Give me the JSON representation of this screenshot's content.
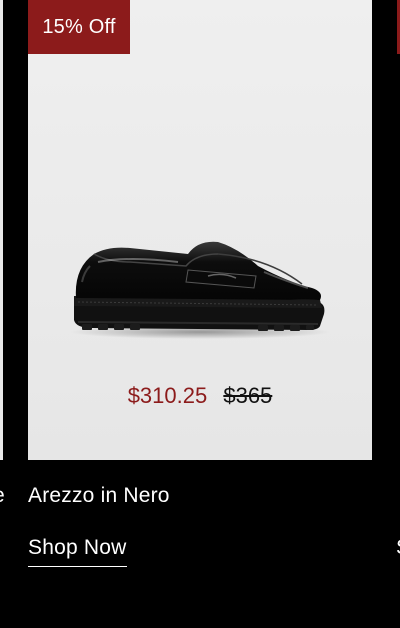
{
  "carousel": {
    "previous_card": {
      "name_fragment": "e"
    },
    "next_card": {
      "name_fragment": "S"
    }
  },
  "product": {
    "badge": "15% Off",
    "image_icon": "loafer-shoe-image",
    "sale_price": "$310.25",
    "original_price": "$365",
    "name": "Arezzo in Nero",
    "cta_label": "Shop Now"
  },
  "colors": {
    "badge_background": "#8c1b1b",
    "sale_price": "#8c1b1b",
    "page_background": "#000000",
    "card_background": "#ececec"
  }
}
